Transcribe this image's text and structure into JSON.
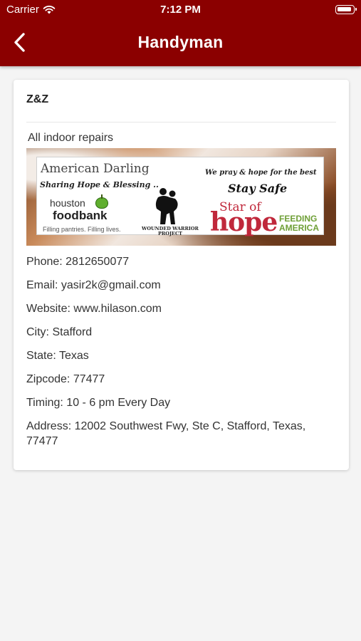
{
  "status_bar": {
    "carrier": "Carrier",
    "time": "7:12 PM"
  },
  "nav": {
    "title": "Handyman"
  },
  "listing": {
    "name": "Z&Z",
    "description": "All indoor repairs",
    "banner": {
      "brand": "American Darling",
      "tagline": "Sharing Hope & Blessing ..",
      "foodbank_line1": "houston",
      "foodbank_line2": "foodbank",
      "foodbank_line3": "Filling pantries. Filling lives.",
      "wwp": "WOUNDED WARRIOR PROJECT",
      "pray": "We pray & hope for the best",
      "stay_safe": "Stay Safe",
      "star_of": "Star of",
      "hope": "hope",
      "feeding": "FEEDING",
      "america": "AMERICA"
    },
    "phone": "Phone: 2812650077",
    "email": "Email: yasir2k@gmail.com",
    "website": "Website: www.hilason.com",
    "city": "City: Stafford",
    "state": "State: Texas",
    "zipcode": "Zipcode: 77477",
    "timing": "Timing: 10 - 6 pm Every Day",
    "address": "Address: 12002 Southwest Fwy, Ste C, Stafford, Texas, 77477"
  },
  "colors": {
    "header": "#8b0000",
    "background": "#f4f4f4"
  },
  "icons": {
    "back": "chevron-left-icon",
    "wifi": "wifi-icon",
    "battery": "battery-icon"
  }
}
